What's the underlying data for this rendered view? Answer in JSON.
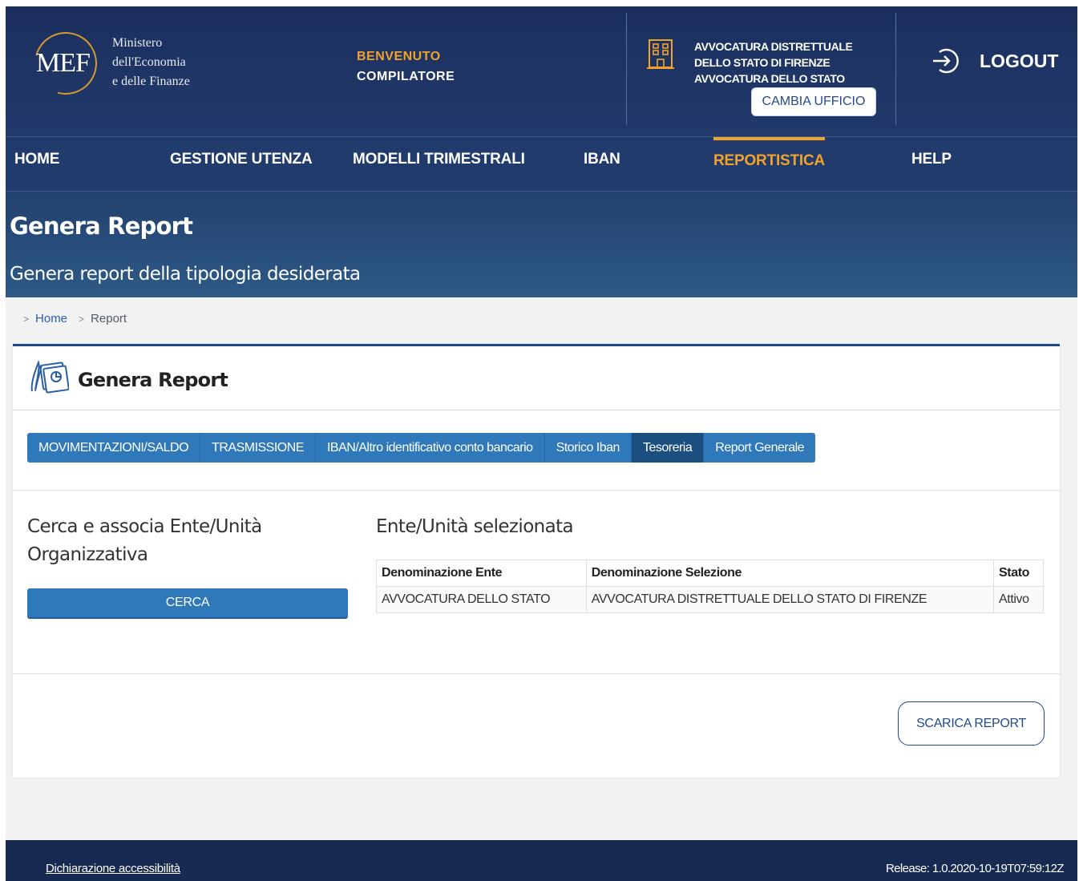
{
  "header": {
    "logo_text": "MEF",
    "ministry_lines": [
      "Ministero",
      "dell'Economia",
      "e delle Finanze"
    ],
    "welcome_label": "BENVENUTO",
    "user_role": "COMPILATORE",
    "office_lines": [
      "AVVOCATURA DISTRETTUALE",
      "DELLO STATO DI FIRENZE",
      "AVVOCATURA DELLO STATO"
    ],
    "change_office_label": "CAMBIA UFFICIO",
    "logout_label": "LOGOUT",
    "icons": {
      "office": "building-icon",
      "logout": "logout-icon"
    }
  },
  "nav": {
    "items": [
      {
        "label": "HOME"
      },
      {
        "label": "GESTIONE UTENZA"
      },
      {
        "label": "MODELLI TRIMESTRALI"
      },
      {
        "label": "IBAN"
      },
      {
        "label": "REPORTISTICA"
      },
      {
        "label": "HELP"
      }
    ],
    "active": "REPORTISTICA"
  },
  "page": {
    "title": "Genera Report",
    "subtitle": "Genera report della tipologia desiderata"
  },
  "breadcrumb": {
    "separator": ">",
    "items": [
      "Home",
      "Report"
    ]
  },
  "card": {
    "title": "Genera Report",
    "tabs": [
      {
        "label": "MOVIMENTAZIONI/SALDO"
      },
      {
        "label": "TRASMISSIONE"
      },
      {
        "label": "IBAN/Altro identificativo conto bancario"
      },
      {
        "label": "Storico Iban"
      },
      {
        "label": "Tesoreria"
      },
      {
        "label": "Report Generale"
      }
    ],
    "active_tab": "Tesoreria",
    "search_title": "Cerca e associa Ente/Unità Organizzativa",
    "search_button": "CERCA",
    "selected_title": "Ente/Unità selezionata",
    "table": {
      "headers": [
        "Denominazione Ente",
        "Denominazione Selezione",
        "Stato"
      ],
      "rows": [
        [
          "AVVOCATURA DELLO STATO",
          "AVVOCATURA DISTRETTUALE DELLO STATO DI FIRENZE",
          "Attivo"
        ]
      ]
    },
    "download_button": "SCARICA REPORT"
  },
  "footer": {
    "accessibility_link": "Dichiarazione accessibilità",
    "release": "Release: 1.0.2020-10-19T07:59:12Z"
  },
  "colors": {
    "header_bg": "#1b2f5e",
    "accent_orange": "#f2a22a",
    "tab_blue": "#2f79ba",
    "tab_active": "#1b4f80",
    "footer_bg": "#172a52"
  }
}
